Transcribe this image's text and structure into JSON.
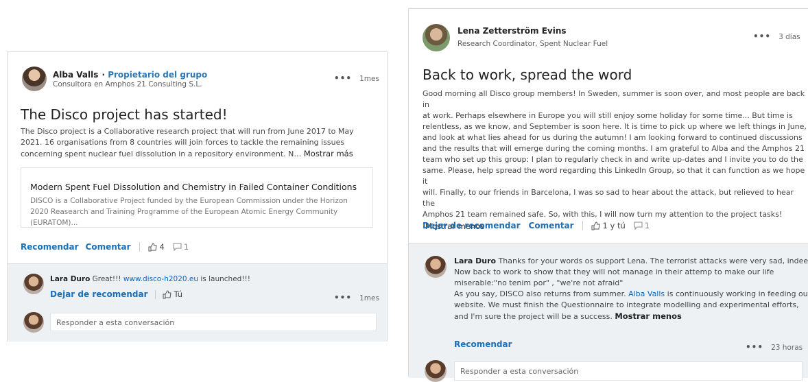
{
  "post1": {
    "author": "Alba Valls",
    "owner_badge": "Propietario del grupo",
    "headline": "Consultora en Amphos 21 Consulting S.L.",
    "time": "1mes",
    "title": "The Disco project has started!",
    "body": "The Disco project is a Collaborative research project that will run from June 2017 to May 2021. 16 organisations from 8 countries will join forces to tackle the remaining issues concerning spent nuclear fuel dissolution in a repository environment. N…",
    "show_more": "Mostrar más",
    "link_card": {
      "title": "Modern Spent Fuel Dissolution and Chemistry in Failed Container Conditions",
      "description": "DISCO is a Collaborative Project funded by the European Commission under the Horizon 2020 Reasearch and Training Programme of the European Atomic Energy Community (EURATOM)..."
    },
    "actions": {
      "like": "Recomendar",
      "comment": "Comentar",
      "like_count": "4",
      "comment_count": "1"
    },
    "comment": {
      "author": "Lara Duro",
      "text_before": "Great!!!",
      "link": "www.disco-h2020.eu",
      "text_after": "is launched!!!",
      "unlike": "Dejar de recomendar",
      "likes": "Tú",
      "time": "1mes"
    },
    "reply_placeholder": "Responder a esta conversación"
  },
  "post2": {
    "author": "Lena Zetterström Evins",
    "headline": "Research Coordinator, Spent Nuclear Fuel",
    "time": "3 días",
    "title": "Back to work, spread the word",
    "body_lines": [
      "Good morning all Disco group members! In Sweden, summer is soon over, and most people are back in",
      "at work. Perhaps elsewhere in Europe you will still enjoy some holiday for some time... But time is",
      "relentless, as we know, and September is soon here. It is time to pick up where we left things in June,",
      "and look at what lies ahead for us during the autumn! I am looking forward to continued discussions",
      "and the results that will emerge during the coming months. I am grateful to Alba and the Amphos 21",
      "team who set up this group: I plan to regularly check in and write up-dates and I invite you to do the",
      "same. Please, help spread the word regarding this LinkedIn Group, so that it can function as we hope it",
      "will. Finally, to our friends in Barcelona, I was so sad to hear about the attack, but relieved to hear the",
      "Amphos 21 team remained safe. So, with this, I will now turn my attention to the project tasks!"
    ],
    "show_less": "Mostrar menos",
    "actions": {
      "unlike": "Dejar de recomendar",
      "comment": "Comentar",
      "likes": "1 y tú",
      "comment_count": "1"
    },
    "comment": {
      "author": "Lara Duro",
      "line1": "Thanks for your words os support Lena. The terrorist attacks were very sad, indeed.",
      "line2": "Now back to work to show that they will not manage in their attemp to make our life",
      "line3": "miserable:\"no tenim por\" , \"we're not afraid\"",
      "line4_before": "As you say, DISCO also returns from summer.",
      "line4_link": "Alba Valls",
      "line4_after": "is continuously working in feeding our",
      "line5": "website. We must finish the Questionnaire to integrate modelling and experimental efforts,",
      "line6": "and I'm sure the project will be a success.",
      "show_less": "Mostrar menos",
      "like": "Recomendar",
      "time": "23 horas"
    },
    "reply_placeholder": "Responder a esta conversación"
  }
}
